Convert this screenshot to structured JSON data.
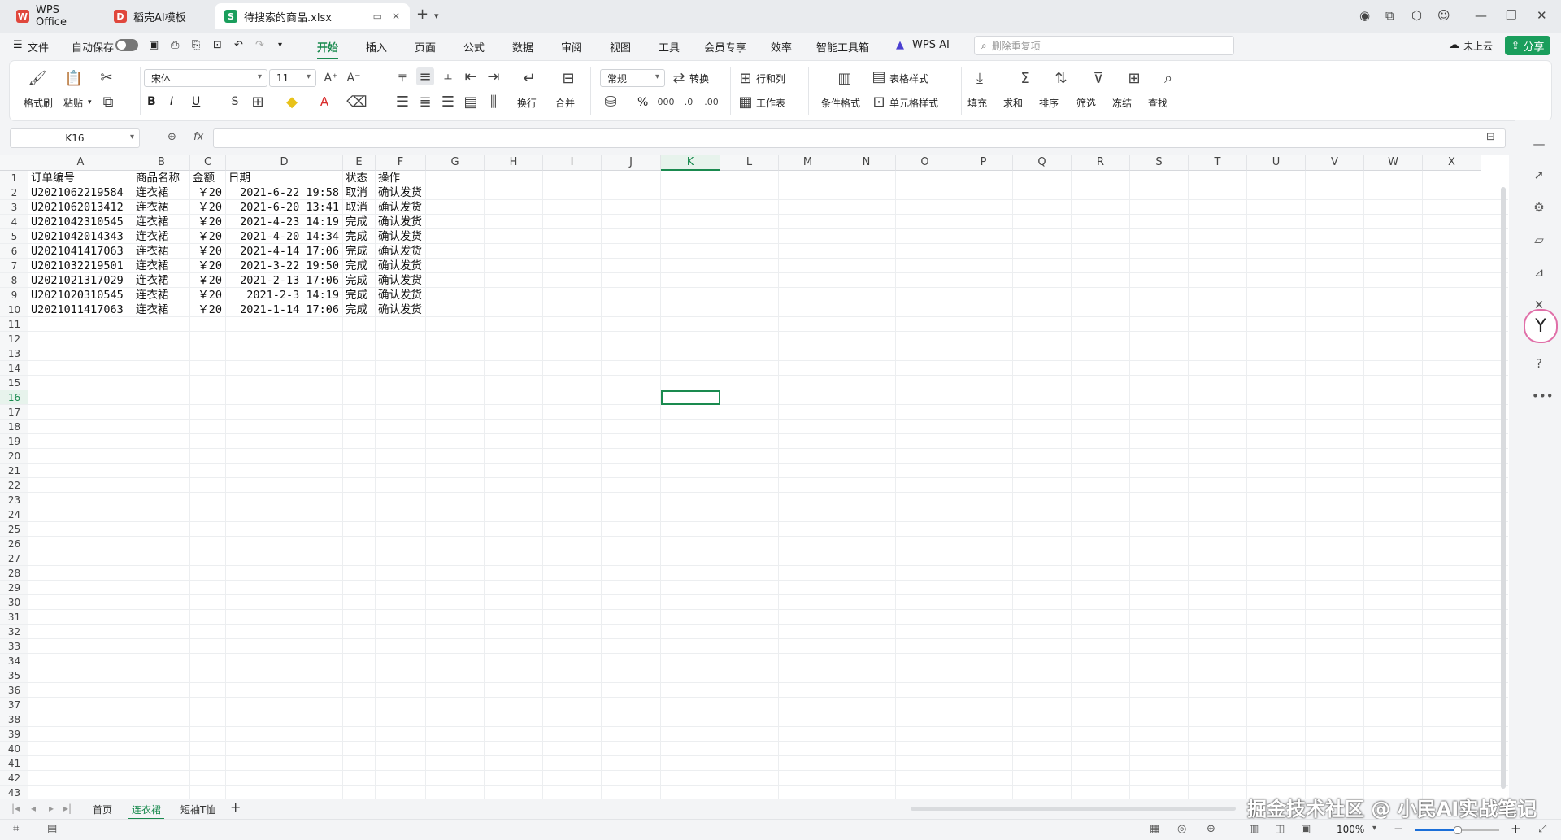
{
  "titlebar": {
    "tabs": [
      {
        "label": "WPS Office",
        "logo": "W",
        "color": "#e0473c"
      },
      {
        "label": "稻壳AI模板",
        "logo": "D",
        "color": "#e0473c"
      },
      {
        "label": "待搜索的商品.xlsx",
        "logo": "S",
        "color": "#1a9e5c"
      }
    ],
    "new_tab": "+"
  },
  "menubar": {
    "file": "文件",
    "autosave": "自动保存",
    "tabs": [
      "开始",
      "插入",
      "页面",
      "公式",
      "数据",
      "审阅",
      "视图",
      "工具",
      "会员专享",
      "效率",
      "智能工具箱",
      "WPS AI"
    ],
    "active_tab": "开始",
    "search_placeholder": "删除重复项",
    "cloud": "未上云",
    "share": "分享"
  },
  "ribbon": {
    "format_painter": "格式刷",
    "paste": "粘贴",
    "font_name": "宋体",
    "font_size": "11",
    "number_format": "常规",
    "convert": "转换",
    "rows_cols": "行和列",
    "worksheet": "工作表",
    "wrap": "换行",
    "merge": "合并",
    "cond_format": "条件格式",
    "table_style": "表格样式",
    "cell_style": "单元格样式",
    "fill": "填充",
    "sum": "求和",
    "sort": "排序",
    "filter": "筛选",
    "freeze": "冻结",
    "find": "查找",
    "bold": "B",
    "italic": "I",
    "underline": "U",
    "percent": "%"
  },
  "formula_bar": {
    "name_box": "K16",
    "fx": "fx",
    "content": ""
  },
  "sheet": {
    "columns": [
      "A",
      "B",
      "C",
      "D",
      "E",
      "F",
      "G",
      "H",
      "I",
      "J",
      "K",
      "L",
      "M",
      "N",
      "O",
      "P",
      "Q",
      "R",
      "S",
      "T",
      "U",
      "V",
      "W",
      "X"
    ],
    "selected_column": "K",
    "selected_row": 16,
    "row_count": 43,
    "header_row": [
      "订单编号",
      "商品名称",
      "金额",
      "日期",
      "状态",
      "操作"
    ],
    "rows": [
      [
        "U2021062219584",
        "连衣裙",
        "￥20",
        "2021-6-22 19:58",
        "取消",
        "确认发货"
      ],
      [
        "U2021062013412",
        "连衣裙",
        "￥20",
        "2021-6-20 13:41",
        "取消",
        "确认发货"
      ],
      [
        "U2021042310545",
        "连衣裙",
        "￥20",
        "2021-4-23 14:19",
        "完成",
        "确认发货"
      ],
      [
        "U2021042014343",
        "连衣裙",
        "￥20",
        "2021-4-20 14:34",
        "完成",
        "确认发货"
      ],
      [
        "U2021041417063",
        "连衣裙",
        "￥20",
        "2021-4-14 17:06",
        "完成",
        "确认发货"
      ],
      [
        "U2021032219501",
        "连衣裙",
        "￥20",
        "2021-3-22 19:50",
        "完成",
        "确认发货"
      ],
      [
        "U2021021317029",
        "连衣裙",
        "￥20",
        "2021-2-13 17:06",
        "完成",
        "确认发货"
      ],
      [
        "U2021020310545",
        "连衣裙",
        "￥20",
        "2021-2-3 14:19",
        "完成",
        "确认发货"
      ],
      [
        "U2021011417063",
        "连衣裙",
        "￥20",
        "2021-1-14 17:06",
        "完成",
        "确认发货"
      ]
    ]
  },
  "sheet_tabs": {
    "tabs": [
      "首页",
      "连衣裙",
      "短袖T恤"
    ],
    "active": "连衣裙",
    "add": "+"
  },
  "statusbar": {
    "zoom": "100%"
  },
  "watermark": "掘金技术社区 @ 小民AI实战笔记",
  "colors": {
    "accent": "#1a8a4f",
    "share": "#1a9e5c"
  }
}
